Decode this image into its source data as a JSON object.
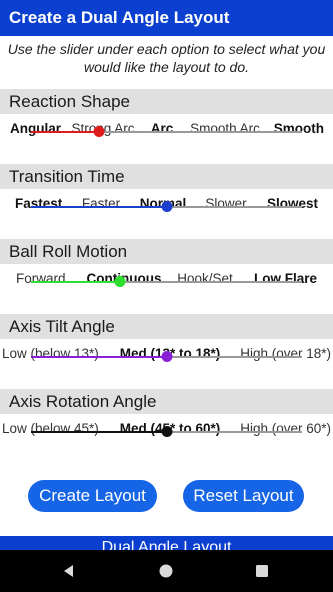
{
  "header": {
    "title": "Create a Dual Angle Layout"
  },
  "intro": {
    "line1": "Use the slider under each option to select what you",
    "line2": "would like the layout to do."
  },
  "sections": [
    {
      "title": "Reaction Shape",
      "options": [
        "Angular",
        "Strong Arc",
        "Arc",
        "Smooth Arc",
        "Smooth"
      ],
      "bold": [
        true,
        false,
        true,
        false,
        true
      ],
      "slider_value": 0.25,
      "color": "#e01b1b"
    },
    {
      "title": "Transition Time",
      "options": [
        "Fastest",
        "Faster",
        "Normal",
        "Slower",
        "Slowest"
      ],
      "bold": [
        true,
        false,
        true,
        false,
        true
      ],
      "slider_value": 0.5,
      "color": "#1d3fd0"
    },
    {
      "title": "Ball Roll Motion",
      "options": [
        "Forward",
        "Continuous",
        "Hook/Set",
        "Low Flare"
      ],
      "bold": [
        false,
        true,
        false,
        true
      ],
      "slider_value": 0.33,
      "color": "#2ee02e"
    },
    {
      "title": "Axis Tilt Angle",
      "options": [
        "Low (below 13*)",
        "Med (13* to 18*)",
        "High (over 18*)"
      ],
      "bold": [
        false,
        true,
        false
      ],
      "slider_value": 0.5,
      "color": "#8a1fd6"
    },
    {
      "title": "Axis Rotation Angle",
      "options": [
        "Low (below 45*)",
        "Med (45* to 60*)",
        "High (over 60*)"
      ],
      "bold": [
        false,
        true,
        false
      ],
      "slider_value": 0.5,
      "color": "#111111"
    }
  ],
  "buttons": {
    "create_label": "Create Layout",
    "reset_label": "Reset Layout"
  },
  "footer": {
    "title": "Dual Angle Layout"
  },
  "nav_icons": [
    "back-icon",
    "home-icon",
    "recents-icon"
  ]
}
